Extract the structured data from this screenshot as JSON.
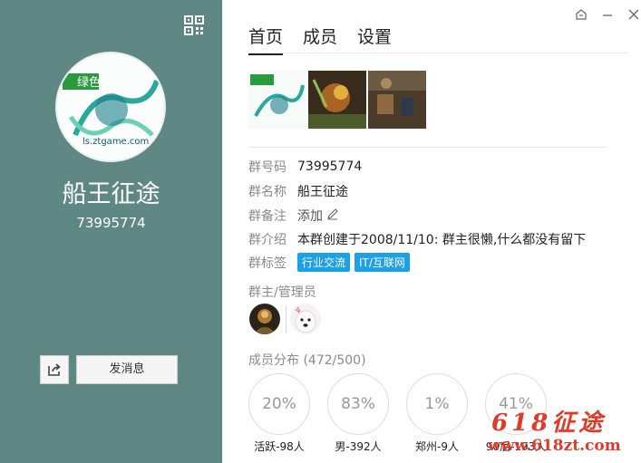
{
  "left_panel": {
    "group_name": "船王征途",
    "group_id": "73995774",
    "send_message_label": "发消息",
    "avatar_text": "ls.ztgame.com",
    "bg_color": "#5f8783"
  },
  "tabs": [
    {
      "label": "首页",
      "active": true
    },
    {
      "label": "成员",
      "active": false
    },
    {
      "label": "设置",
      "active": false
    }
  ],
  "info": {
    "id_label": "群号码",
    "id_value": "73995774",
    "name_label": "群名称",
    "name_value": "船王征途",
    "remark_label": "群备注",
    "remark_value": "添加",
    "intro_label": "群介绍",
    "intro_value": "本群创建于2008/11/10:  群主很懒,什么都没有留下",
    "tags_label": "群标签",
    "tags": [
      "行业交流",
      "IT/互联网"
    ],
    "tag_color": "#1ea0e6"
  },
  "admins": {
    "title": "群主/管理员"
  },
  "members": {
    "title": "成员分布",
    "count": "(472/500)",
    "stats": [
      {
        "percent": "20%",
        "label": "活跃-98人"
      },
      {
        "percent": "83%",
        "label": "男-392人"
      },
      {
        "percent": "1%",
        "label": "郑州-9人"
      },
      {
        "percent": "41%",
        "label": "90后-193人"
      }
    ]
  },
  "watermark": {
    "title": "618征途",
    "url": "www.618zt.com",
    "color": "#e03a2a"
  },
  "icons": [
    "qr-code-icon",
    "skin-icon",
    "minimize-icon",
    "close-icon",
    "share-icon",
    "edit-pencil-icon"
  ]
}
